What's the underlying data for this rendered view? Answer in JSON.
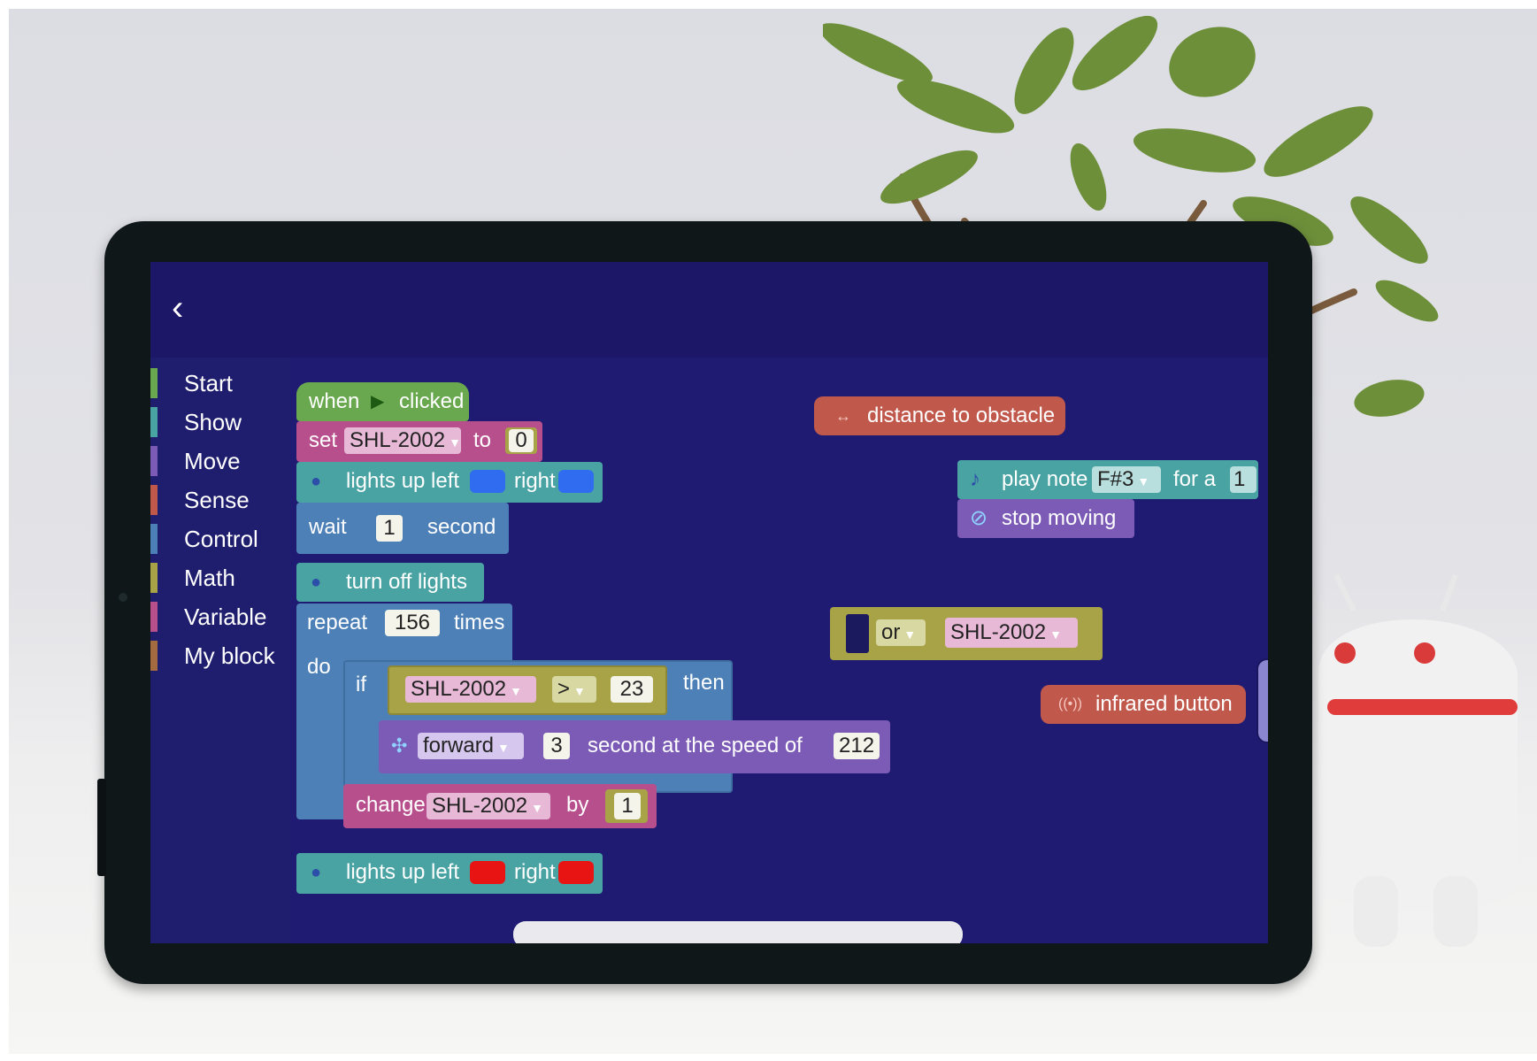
{
  "screen": {
    "back_icon": "chevron-left-icon",
    "back_glyph": "‹"
  },
  "sidebar": {
    "items": [
      {
        "label": "Start",
        "color": "#6aa84f"
      },
      {
        "label": "Show",
        "color": "#4aa3a3"
      },
      {
        "label": "Move",
        "color": "#7b5bb5"
      },
      {
        "label": "Sense",
        "color": "#c0584c"
      },
      {
        "label": "Control",
        "color": "#4e80b8"
      },
      {
        "label": "Math",
        "color": "#a9a348"
      },
      {
        "label": "Variable",
        "color": "#b84f8d"
      },
      {
        "label": "My block",
        "color": "#a56b40"
      }
    ]
  },
  "blocks": {
    "when_clicked": {
      "when": "when",
      "clicked": "clicked",
      "icon": "play-flag-icon"
    },
    "set_var": {
      "set": "set",
      "var": "SHL-2002",
      "to": "to",
      "value": "0"
    },
    "lights_up_1": {
      "label": "lights up left",
      "right": "right",
      "left_color": "#2f6cf0",
      "right_color": "#2f6cf0"
    },
    "wait": {
      "wait": "wait",
      "value": "1",
      "second": "second"
    },
    "turn_off": {
      "label": "turn off lights"
    },
    "repeat": {
      "repeat": "repeat",
      "value": "156",
      "times": "times",
      "do": "do"
    },
    "if_block": {
      "if": "if",
      "var": "SHL-2002",
      "op": ">",
      "value": "23",
      "then": "then"
    },
    "forward": {
      "dir": "forward",
      "value": "3",
      "text": "second at the speed of",
      "speed": "212"
    },
    "change": {
      "change": "change",
      "var": "SHL-2002",
      "by": "by",
      "value": "1"
    },
    "lights_up_2": {
      "label": "lights up left",
      "right": "right",
      "left_color": "#e81414",
      "right_color": "#e81414"
    },
    "distance": {
      "label": "distance to obstacle"
    },
    "play_note": {
      "label": "play note",
      "note": "F#3",
      "for_a": "for a",
      "value": "1"
    },
    "stop_moving": {
      "label": "stop moving"
    },
    "or_block": {
      "or": "or",
      "var": "SHL-2002"
    },
    "infrared": {
      "label": "infrared button"
    }
  },
  "colors": {
    "screen_bg": "#1c1866",
    "start": "#6aa84f",
    "show": "#4aa3a3",
    "move": "#7b5bb5",
    "sense": "#c0584c",
    "control": "#4e80b8",
    "math": "#a9a348",
    "variable": "#b84f8d"
  }
}
